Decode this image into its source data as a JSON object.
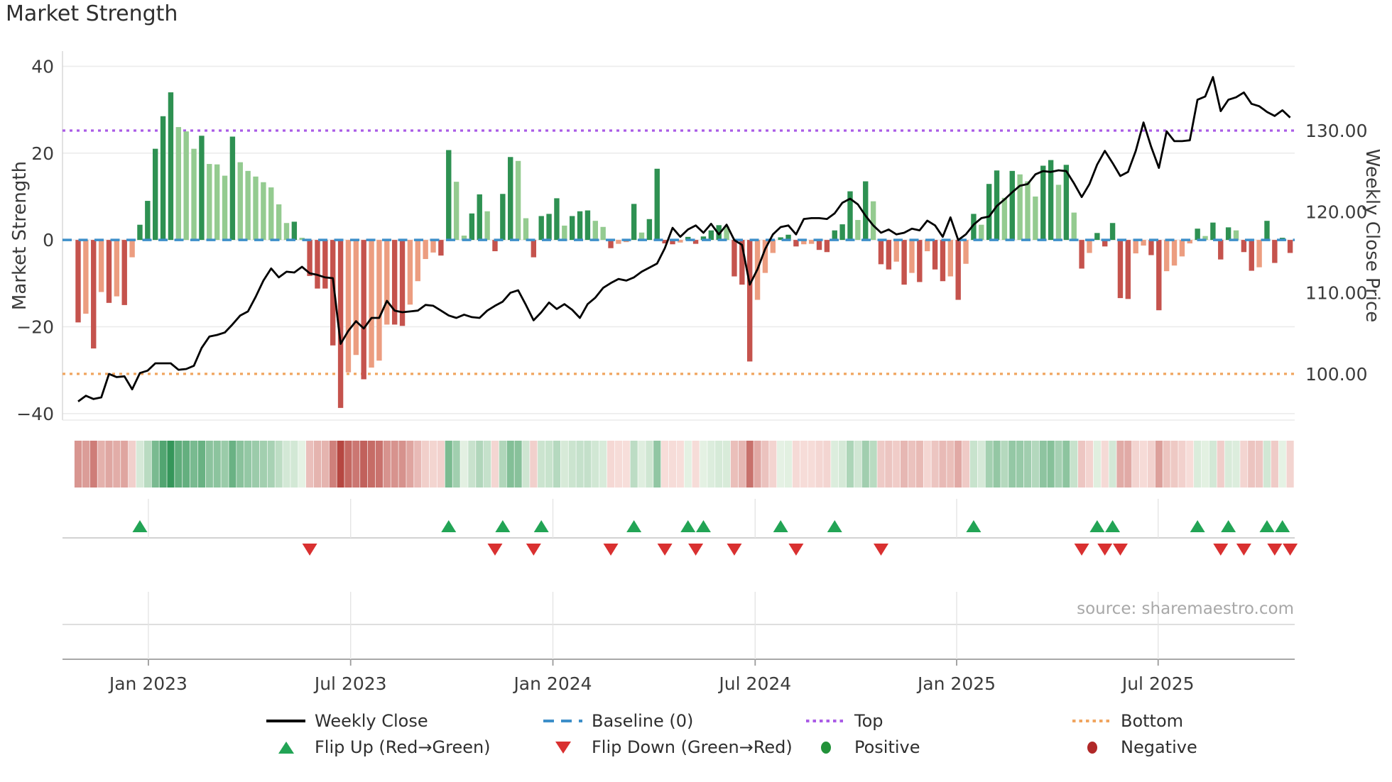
{
  "title": "Market Strength",
  "source": "source: sharemaestro.com",
  "legend": {
    "items": [
      {
        "id": "weekly-close",
        "label": "Weekly Close"
      },
      {
        "id": "baseline",
        "label": "Baseline (0)"
      },
      {
        "id": "top",
        "label": "Top"
      },
      {
        "id": "bottom",
        "label": "Bottom"
      },
      {
        "id": "flip-up",
        "label": "Flip Up (Red→Green)"
      },
      {
        "id": "flip-down",
        "label": "Flip Down (Green→Red)"
      },
      {
        "id": "positive",
        "label": "Positive"
      },
      {
        "id": "negative",
        "label": "Negative"
      }
    ]
  },
  "chart_data": {
    "type": "combo: weekly bar (market strength) + line (weekly close) + heatmap strip + flip markers",
    "n_weeks": 158,
    "left_axis": {
      "label": "Market Strength",
      "ticks": [
        40,
        20,
        0,
        -20,
        -40
      ],
      "tick_labels": [
        "40",
        "20",
        "0",
        "−20",
        "−40"
      ],
      "range": [
        -41.5,
        43.5
      ]
    },
    "right_axis": {
      "label": "Weekly Close Price",
      "ticks": [
        130,
        120,
        110,
        100
      ],
      "tick_labels": [
        "130.00",
        "120.00",
        "110.00",
        "100.00"
      ],
      "range": [
        94.3,
        139.8
      ]
    },
    "x_ticks": {
      "labels": [
        "Jan 2023",
        "Jul 2023",
        "Jan 2024",
        "Jul 2024",
        "Jan 2025",
        "Jul 2025"
      ],
      "indices": [
        9.1,
        35.3,
        61.5,
        87.7,
        113.8,
        139.9
      ]
    },
    "reference_lines": {
      "baseline": {
        "label": "Baseline (0)",
        "value": 0
      },
      "top": {
        "label": "Top",
        "price": 130.0
      },
      "bottom": {
        "label": "Bottom",
        "price": 100.0
      }
    },
    "strength": [
      -19,
      -17,
      -25,
      -12,
      -14.5,
      -13,
      -15,
      -4,
      3.5,
      9,
      21,
      28.5,
      34,
      26,
      25,
      21,
      24,
      17.5,
      17.4,
      14.8,
      23.8,
      17.9,
      15.9,
      14.6,
      13.3,
      12.1,
      8.2,
      3.9,
      4.2,
      0.5,
      -8.3,
      -11.2,
      -11.2,
      -24.3,
      -38.7,
      -30.5,
      -26.5,
      -32.1,
      -29.4,
      -27.8,
      -19.5,
      -19.5,
      -19.8,
      -14.9,
      -9.5,
      -4.4,
      -2.9,
      -3.6,
      20.7,
      13.4,
      1.0,
      6.1,
      10.5,
      6.6,
      -2.6,
      10.6,
      19.1,
      18.2,
      5.0,
      -4.0,
      5.5,
      6.0,
      9.6,
      3.3,
      5.5,
      6.6,
      6.8,
      4.4,
      3.0,
      -1.9,
      -0.9,
      -0.5,
      8.3,
      1.7,
      4.8,
      16.4,
      -0.8,
      -1.0,
      -0.6,
      0.7,
      -0.9,
      0.8,
      2.2,
      3.4,
      3.1,
      -8.4,
      -10.3,
      -28,
      -13.8,
      -7.6,
      -3.0,
      0.6,
      1.2,
      -1.5,
      -1.0,
      -0.9,
      -2.3,
      -2.8,
      2.2,
      3.6,
      11.2,
      4.6,
      13.5,
      8.9,
      -5.6,
      -6.8,
      -5.0,
      -10.3,
      -7.6,
      -9.7,
      -2.6,
      -6.8,
      -9.5,
      -8.4,
      -13.8,
      -5.5,
      6.0,
      3.5,
      12.9,
      16.0,
      9.7,
      15.9,
      15.1,
      13.5,
      10.0,
      17.1,
      18.4,
      12.7,
      17.3,
      6.3,
      -6.6,
      -3.0,
      1.6,
      -1.5,
      3.9,
      -13.4,
      -13.6,
      -3.1,
      -1.3,
      -3.5,
      -16.2,
      -7.2,
      -5.9,
      -3.8,
      -0.8,
      2.6,
      0.9,
      4.0,
      -4.5,
      2.9,
      2.2,
      -2.8,
      -7.1,
      -6.3,
      4.4,
      -5.3,
      0.5,
      -3.0
    ],
    "weekly_close": [
      96.6,
      97.3,
      96.9,
      97.1,
      100.0,
      99.6,
      99.7,
      98.1,
      100.1,
      100.4,
      101.3,
      101.3,
      101.3,
      100.5,
      100.6,
      101.0,
      103.2,
      104.6,
      104.8,
      105.1,
      106.1,
      107.2,
      107.7,
      109.5,
      111.5,
      113.0,
      111.9,
      112.6,
      112.5,
      113.2,
      112.4,
      112.2,
      111.9,
      111.8,
      103.7,
      105.3,
      106.5,
      105.6,
      106.9,
      106.9,
      109.0,
      107.8,
      107.6,
      107.7,
      107.8,
      108.5,
      108.4,
      107.8,
      107.2,
      106.9,
      107.3,
      107.0,
      106.9,
      107.8,
      108.4,
      108.9,
      110.0,
      110.3,
      108.5,
      106.6,
      107.6,
      108.8,
      108.0,
      108.6,
      107.9,
      106.9,
      108.6,
      109.4,
      110.6,
      111.2,
      111.7,
      111.5,
      111.9,
      112.6,
      113.1,
      113.6,
      115.5,
      118.0,
      116.9,
      117.8,
      118.3,
      117.4,
      118.5,
      117.2,
      118.4,
      116.5,
      115.9,
      111.0,
      112.9,
      115.4,
      117.2,
      118.1,
      118.3,
      117.2,
      119.1,
      119.2,
      119.2,
      119.1,
      119.8,
      121.1,
      121.6,
      120.9,
      119.5,
      118.3,
      117.4,
      117.8,
      117.2,
      117.4,
      117.9,
      117.7,
      118.9,
      118.3,
      116.9,
      119.3,
      116.5,
      117.2,
      118.4,
      119.2,
      119.4,
      120.7,
      121.5,
      122.4,
      123.2,
      123.4,
      124.6,
      125.0,
      124.9,
      125.1,
      125.0,
      123.5,
      121.8,
      123.4,
      125.8,
      127.5,
      126.0,
      124.4,
      124.9,
      127.5,
      131.0,
      128.0,
      125.4,
      129.9,
      128.7,
      128.7,
      128.8,
      133.8,
      134.2,
      136.6,
      132.4,
      133.8,
      134.1,
      134.7,
      133.3,
      133.0,
      132.3,
      131.8,
      132.5,
      131.6
    ],
    "flip_up": [
      8,
      48,
      55,
      60,
      72,
      79,
      81,
      91,
      98,
      116,
      132,
      134,
      145,
      149,
      154,
      156
    ],
    "flip_down": [
      30,
      54,
      59,
      69,
      76,
      80,
      85,
      93,
      104,
      130,
      133,
      135,
      148,
      151,
      155,
      157
    ],
    "colors": {
      "bar_green_dark": "#2e9152",
      "bar_green_light": "#94cb90",
      "bar_red_dark": "#c5534d",
      "bar_red_light": "#ec9d80",
      "line": "#000000",
      "baseline": "#3d8fc9",
      "top_line": "#aa5ce6",
      "bottom_line": "#f0a55f",
      "flip_up": "#22a455",
      "flip_down": "#d93030",
      "positive_dot": "#22923a",
      "negative_dot": "#b02828",
      "grid": "#ececec",
      "axis_text": "#3b3b3b"
    }
  }
}
